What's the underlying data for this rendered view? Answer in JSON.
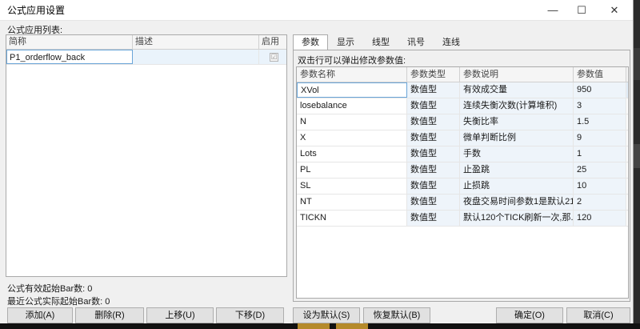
{
  "window": {
    "title": "公式应用设置",
    "minimize_glyph": "—",
    "maximize_glyph": "☐",
    "close_glyph": "✕"
  },
  "left": {
    "list_label": "公式应用列表:",
    "columns": [
      "简称",
      "描述",
      "启用"
    ],
    "rows": [
      {
        "name": "P1_orderflow_back",
        "desc": "",
        "enabled": "☑"
      }
    ],
    "info": [
      {
        "label": "公式有效起始Bar数: ",
        "value": "0"
      },
      {
        "label": "最近公式实际起始Bar数: ",
        "value": "0"
      }
    ]
  },
  "tabs": [
    "参数",
    "显示",
    "线型",
    "讯号",
    "连线"
  ],
  "params": {
    "hint": "双击行可以弹出修改参数值:",
    "columns": [
      "参数名称",
      "参数类型",
      "参数说明",
      "参数值"
    ],
    "rows": [
      {
        "name": "XVol",
        "type": "数值型",
        "desc": "有效成交量",
        "value": "950"
      },
      {
        "name": "losebalance",
        "type": "数值型",
        "desc": "连续失衡次数(计算堆积)",
        "value": "3"
      },
      {
        "name": "N",
        "type": "数值型",
        "desc": "失衡比率",
        "value": "1.5"
      },
      {
        "name": "X",
        "type": "数值型",
        "desc": "微单判断比例",
        "value": "9"
      },
      {
        "name": "Lots",
        "type": "数值型",
        "desc": "手数",
        "value": "1"
      },
      {
        "name": "PL",
        "type": "数值型",
        "desc": "止盈跳",
        "value": "25"
      },
      {
        "name": "SL",
        "type": "数值型",
        "desc": "止损跳",
        "value": "10"
      },
      {
        "name": "NT",
        "type": "数值型",
        "desc": "夜盘交易时间参数1是默认21...",
        "value": "2"
      },
      {
        "name": "TICKN",
        "type": "数值型",
        "desc": "默认120个TICK刷新一次,那...",
        "value": "120"
      }
    ]
  },
  "buttons": {
    "add": "添加(A)",
    "delete": "删除(R)",
    "up": "上移(U)",
    "down": "下移(D)",
    "set_default": "设为默认(S)",
    "restore_default": "恢复默认(B)",
    "ok": "确定(O)",
    "cancel": "取消(C)"
  }
}
